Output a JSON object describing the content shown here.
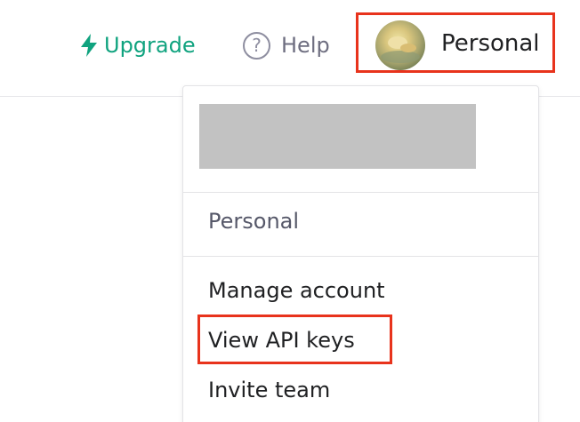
{
  "header": {
    "upgrade_label": "Upgrade",
    "help_label": "Help",
    "help_icon_glyph": "?",
    "account_label": "Personal"
  },
  "menu": {
    "org_label": "Personal",
    "items": [
      {
        "label": "Manage account"
      },
      {
        "label": "View API keys"
      },
      {
        "label": "Invite team"
      }
    ]
  },
  "icons": {
    "upgrade": "lightning-bolt-icon",
    "help": "question-circle-icon"
  },
  "colors": {
    "accent": "#10a37f",
    "highlight": "#e8331c",
    "redacted": "#c2c2c2"
  }
}
